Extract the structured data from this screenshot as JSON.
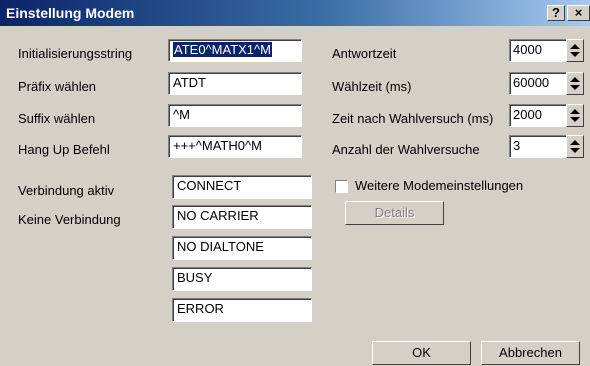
{
  "title": "Einstellung Modem",
  "title_buttons": {
    "help": "?",
    "close": "×"
  },
  "left": [
    {
      "label": "Initialisierungsstring",
      "value": "ATE0^MATX1^M"
    },
    {
      "label": "Präfix wählen",
      "value": "ATDT"
    },
    {
      "label": "Suffix wählen",
      "value": "^M"
    },
    {
      "label": "Hang Up Befehl",
      "value": "+++^MATH0^M"
    }
  ],
  "connect_label": "Verbindung aktiv",
  "noconnect_label": "Keine Verbindung",
  "responses": [
    "CONNECT",
    "NO CARRIER",
    "NO DIALTONE",
    "BUSY",
    "ERROR"
  ],
  "right": [
    {
      "label": "Antwortzeit",
      "value": "4000"
    },
    {
      "label": "Wählzeit (ms)",
      "value": "60000"
    },
    {
      "label": "Zeit nach Wahlversuch (ms)",
      "value": "2000"
    },
    {
      "label": "Anzahl der Wahlversuche",
      "value": "3"
    }
  ],
  "checkbox_label": "Weitere Modemeinstellungen",
  "details_button": "Details",
  "ok_button": "OK",
  "cancel_button": "Abbrechen"
}
